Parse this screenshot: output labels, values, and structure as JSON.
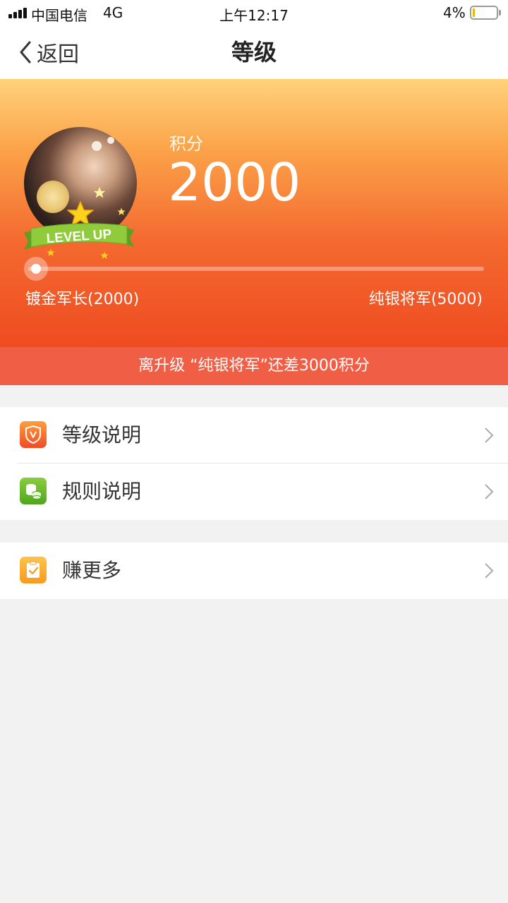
{
  "status_bar": {
    "carrier": "中国电信",
    "network": "4G",
    "time": "上午12:17",
    "battery_percent": "4%"
  },
  "nav": {
    "back_label": "返回",
    "title": "等级"
  },
  "hero": {
    "points_label": "积分",
    "points_value": "2000",
    "badge_text": "LEVEL UP",
    "current_level": "镀金军长(2000)",
    "next_level": "纯银将军(5000)",
    "progress_fraction": 0.0
  },
  "upgrade_notice": "离升级 “纯银将军”还差3000积分",
  "menu": {
    "level_info": "等级说明",
    "rules": "规则说明",
    "earn_more": "赚更多"
  },
  "colors": {
    "accent": "#f05f45",
    "hero_top": "#ffd27a",
    "hero_bottom": "#ef4b21"
  }
}
